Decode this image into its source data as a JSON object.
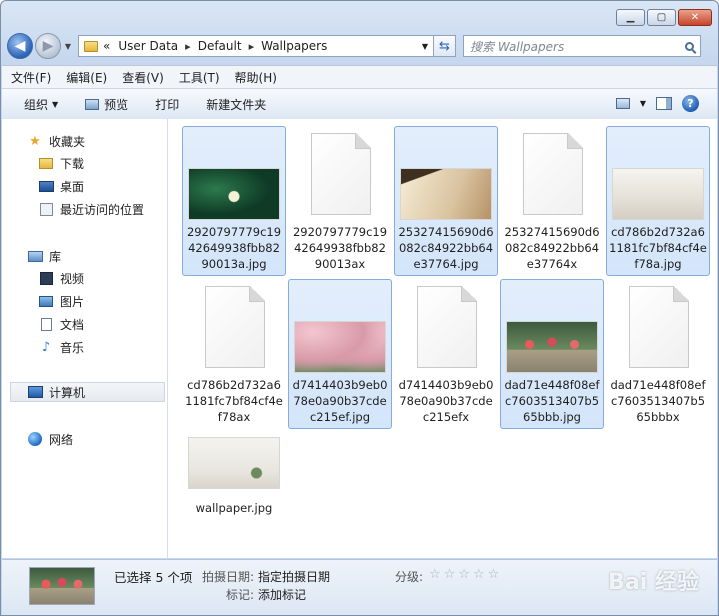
{
  "navbar": {
    "breadcrumbs": [
      "User Data",
      "Default",
      "Wallpapers"
    ],
    "overflow_glyph": "«",
    "search_placeholder": "搜索 Wallpapers"
  },
  "menu": [
    "文件(F)",
    "编辑(E)",
    "查看(V)",
    "工具(T)",
    "帮助(H)"
  ],
  "toolbar": {
    "organize": "组织",
    "preview": "预览",
    "print": "打印",
    "new_folder": "新建文件夹"
  },
  "sidebar": {
    "favorites": "收藏夹",
    "downloads": "下载",
    "desktop": "桌面",
    "recent": "最近访问的位置",
    "libraries": "库",
    "videos": "视频",
    "pictures": "图片",
    "documents": "文档",
    "music": "音乐",
    "computer": "计算机",
    "network": "网络"
  },
  "files": [
    {
      "name": "2920797779c1942649938fbb8290013a.jpg",
      "selected": true,
      "thumb": "leaves"
    },
    {
      "name": "2920797779c1942649938fbb8290013ax",
      "selected": false,
      "thumb": "file"
    },
    {
      "name": "25327415690d6082c84922bb64e37764.jpg",
      "selected": true,
      "thumb": "book"
    },
    {
      "name": "25327415690d6082c84922bb64e37764x",
      "selected": false,
      "thumb": "file"
    },
    {
      "name": "cd786b2d732a61181fc7bf84cf4ef78a.jpg",
      "selected": true,
      "thumb": "room"
    },
    {
      "name": "cd786b2d732a61181fc7bf84cf4ef78ax",
      "selected": false,
      "thumb": "file"
    },
    {
      "name": "d7414403b9eb078e0a90b37cdec215ef.jpg",
      "selected": true,
      "thumb": "cherry"
    },
    {
      "name": "d7414403b9eb078e0a90b37cdec215efx",
      "selected": false,
      "thumb": "file"
    },
    {
      "name": "dad71e448f08efc7603513407b565bbb.jpg",
      "selected": true,
      "thumb": "flowers"
    },
    {
      "name": "dad71e448f08efc7603513407b565bbbx",
      "selected": false,
      "thumb": "file"
    },
    {
      "name": "wallpaper.jpg",
      "selected": false,
      "thumb": "wall"
    }
  ],
  "details": {
    "selection": "已选择 5 个项",
    "date_label": "拍摄日期:",
    "date_value": "指定拍摄日期",
    "tags_label": "标记:",
    "tags_value": "添加标记",
    "rating_label": "分级:",
    "rating_stars": "☆☆☆☆☆",
    "watermark": "Bai 经验"
  }
}
